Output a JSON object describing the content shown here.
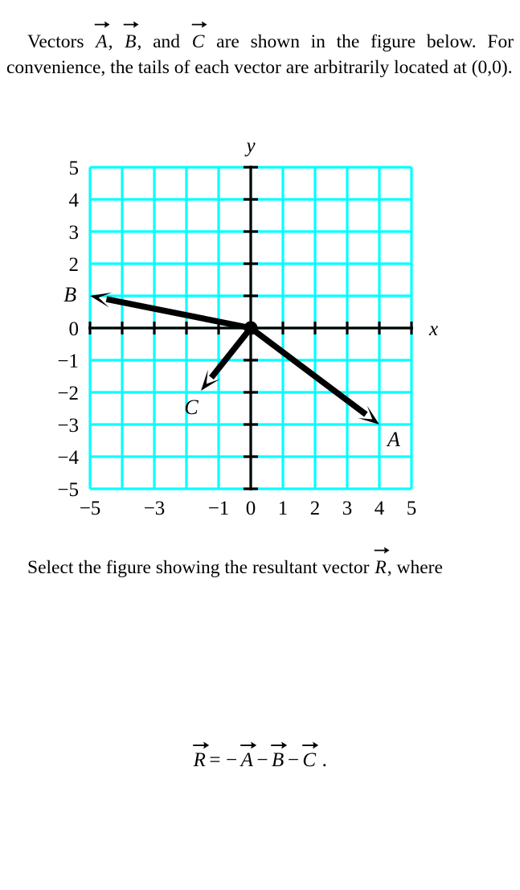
{
  "problem": {
    "intro_lines": [
      "Vectors A⃗, B⃗, and C⃗ are shown in the figure below. For convenience, the tails of each vector are arbitrarily located at (0,0).",
      "Select the figure showing the resultant vector R⃗, where"
    ],
    "intro_part1": "Vectors",
    "intro_part2": ",",
    "intro_part3": ", and",
    "intro_part4": "are shown in the figure below. For convenience, the tails of each vector are arbitrarily located at (0,0).",
    "select_part1": "Select the figure showing the resultant vector",
    "select_part2": ", where",
    "vector_a_symbol": "A",
    "vector_b_symbol": "B",
    "vector_c_symbol": "C",
    "vector_r_symbol": "R"
  },
  "equation": {
    "lhs": "R",
    "equals": "=",
    "minus1": "−",
    "term1": "A",
    "minus2": "−",
    "term2": "B",
    "minus3": "−",
    "term3": "C",
    "period": "."
  },
  "figure": {
    "axis_x_label": "x",
    "axis_y_label": "y",
    "grid_color": "#00ffff",
    "axis_color": "#000000",
    "vector_color": "#000000",
    "x_tick_labels": [
      {
        "value": -5,
        "text": "−5"
      },
      {
        "value": -3,
        "text": "−3"
      },
      {
        "value": -1,
        "text": "−1"
      },
      {
        "value": 0,
        "text": "0"
      },
      {
        "value": 1,
        "text": "1"
      },
      {
        "value": 2,
        "text": "2"
      },
      {
        "value": 3,
        "text": "3"
      },
      {
        "value": 4,
        "text": "4"
      },
      {
        "value": 5,
        "text": "5"
      }
    ],
    "y_tick_labels": [
      {
        "value": 5,
        "text": "5"
      },
      {
        "value": 4,
        "text": "4"
      },
      {
        "value": 3,
        "text": "3"
      },
      {
        "value": 2,
        "text": "2"
      },
      {
        "value": 0,
        "text": "0"
      },
      {
        "value": -1,
        "text": "−1"
      },
      {
        "value": -2,
        "text": "−2"
      },
      {
        "value": -3,
        "text": "−3"
      },
      {
        "value": -4,
        "text": "−4"
      },
      {
        "value": -5,
        "text": "−5"
      }
    ],
    "origin_marker": true,
    "vectors": [
      {
        "name": "A",
        "label": "A",
        "tail": [
          0,
          0
        ],
        "head": [
          4,
          -3
        ],
        "label_pos": [
          4.45,
          -3.45
        ]
      },
      {
        "name": "B",
        "label": "B",
        "tail": [
          0,
          0
        ],
        "head": [
          -5,
          1
        ],
        "label_pos": [
          -5.62,
          1.05
        ]
      },
      {
        "name": "C",
        "label": "C",
        "tail": [
          0,
          0
        ],
        "head": [
          -1.55,
          -1.95
        ],
        "label_pos": [
          -1.85,
          -2.45
        ]
      }
    ]
  },
  "chart_data": {
    "type": "scatter",
    "title": "",
    "xlabel": "x",
    "ylabel": "y",
    "xlim": [
      -5,
      5
    ],
    "ylim": [
      -5,
      5
    ],
    "grid": true,
    "legend": "none",
    "series": [
      {
        "name": "A",
        "x": [
          0,
          4
        ],
        "y": [
          0,
          -3
        ]
      },
      {
        "name": "B",
        "x": [
          0,
          -5
        ],
        "y": [
          0,
          1
        ]
      },
      {
        "name": "C",
        "x": [
          0,
          -1.5
        ],
        "y": [
          0,
          -2
        ]
      }
    ]
  }
}
